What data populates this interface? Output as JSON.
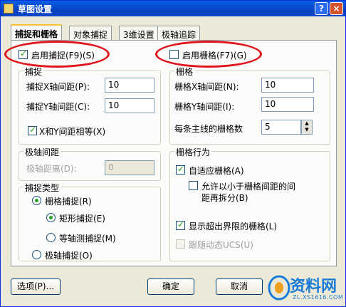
{
  "window": {
    "title": "草图设置",
    "help_label": "?",
    "close_label": "×"
  },
  "tabs": [
    {
      "label": "捕捉和栅格",
      "active": true
    },
    {
      "label": "对象捕捉",
      "active": false
    },
    {
      "label": "3维设置",
      "active": false
    },
    {
      "label": "极轴追踪",
      "active": false
    }
  ],
  "snap": {
    "enable_label": "启用捕捉(F9)(S)",
    "enable_checked": true,
    "group_title": "捕捉",
    "x_label": "捕捉X轴间距(P):",
    "x_value": "10",
    "y_label": "捕捉Y轴间距(C):",
    "y_value": "10",
    "equal_label": "X和Y间距相等(X)",
    "equal_checked": true
  },
  "polar": {
    "group_title": "极轴间距",
    "distance_label": "极轴距离(D):",
    "distance_value": "0"
  },
  "snap_type": {
    "group_title": "捕捉类型",
    "grid_snap_label": "栅格捕捉(R)",
    "rect_snap_label": "矩形捕捉(E)",
    "iso_snap_label": "等轴测捕捉(M)",
    "polar_snap_label": "极轴捕捉(O)",
    "selected": "grid_snap/rect_snap"
  },
  "grid": {
    "enable_label": "启用栅格(F7)(G)",
    "enable_checked": false,
    "group_title": "栅格",
    "x_label": "栅格X轴间距(N):",
    "x_value": "10",
    "y_label": "栅格Y轴间距(I):",
    "y_value": "10",
    "major_label": "每条主线的栅格数",
    "major_value": "5"
  },
  "grid_behavior": {
    "group_title": "栅格行为",
    "adaptive_label": "自适应栅格(A)",
    "adaptive_checked": true,
    "subdivide_label_1": "允许以小于栅格间距的间",
    "subdivide_label_2": "距再拆分(B)",
    "subdivide_checked": false,
    "beyond_label": "显示超出界限的栅格(L)",
    "beyond_checked": true,
    "follow_ucs_label": "跟随动态UCS(U)",
    "follow_ucs_checked": false
  },
  "buttons": {
    "options": "选项(P)...",
    "ok": "确定",
    "cancel": "取消"
  },
  "watermark": {
    "text": "资料网",
    "url": "ZL.XS1616.COM"
  },
  "colors": {
    "highlight_oval": "#e0141c",
    "title_bar": "#0a5fe6",
    "check": "#21a121"
  }
}
